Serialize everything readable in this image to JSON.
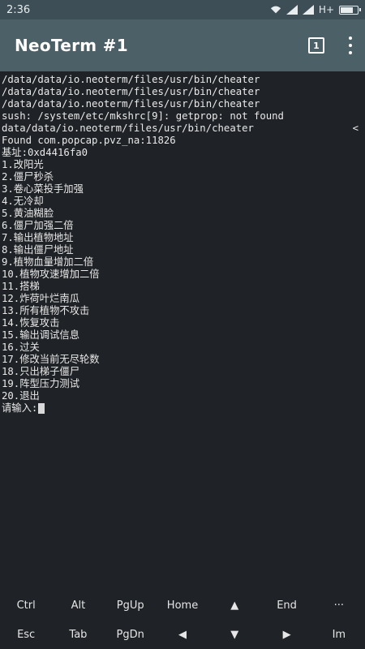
{
  "status_bar": {
    "time": "2:36",
    "network_label": "H+",
    "icons": [
      "wifi-icon",
      "signal-icon",
      "signal-icon",
      "battery-icon"
    ],
    "battery_level": 0.8
  },
  "app_bar": {
    "title": "NeoTerm #1",
    "session_count": "1",
    "more_icon": "more-vertical-icon"
  },
  "terminal": {
    "lines": [
      "/data/data/io.neoterm/files/usr/bin/cheater",
      "/data/data/io.neoterm/files/usr/bin/cheater",
      "/data/data/io.neoterm/files/usr/bin/cheater",
      "sush: /system/etc/mkshrc[9]: getprop: not found",
      "data/data/io.neoterm/files/usr/bin/cheater",
      "Found com.popcap.pvz_na:11826",
      "基址:0xd4416fa0",
      "1.改阳光",
      "2.僵尸秒杀",
      "3.卷心菜投手加强",
      "4.无冷却",
      "5.黄油糊脸",
      "6.僵尸加强二倍",
      "7.输出植物地址",
      "8.输出僵尸地址",
      "9.植物血量增加二倍",
      "10.植物攻速增加二倍",
      "11.搭梯",
      "12.炸荷叶烂南瓜",
      "13.所有植物不攻击",
      "14.恢复攻击",
      "15.输出调试信息",
      "16.过关",
      "17.修改当前无尽轮数",
      "18.只出梯子僵尸",
      "19.阵型压力测试",
      "20.退出"
    ],
    "overflow_mark": "<",
    "prompt": "请输入:"
  },
  "extra_keys": {
    "row1": [
      "Ctrl",
      "Alt",
      "PgUp",
      "Home",
      "▲",
      "End",
      "···"
    ],
    "row2": [
      "Esc",
      "Tab",
      "PgDn",
      "◀",
      "▼",
      "▶",
      "Im"
    ]
  }
}
